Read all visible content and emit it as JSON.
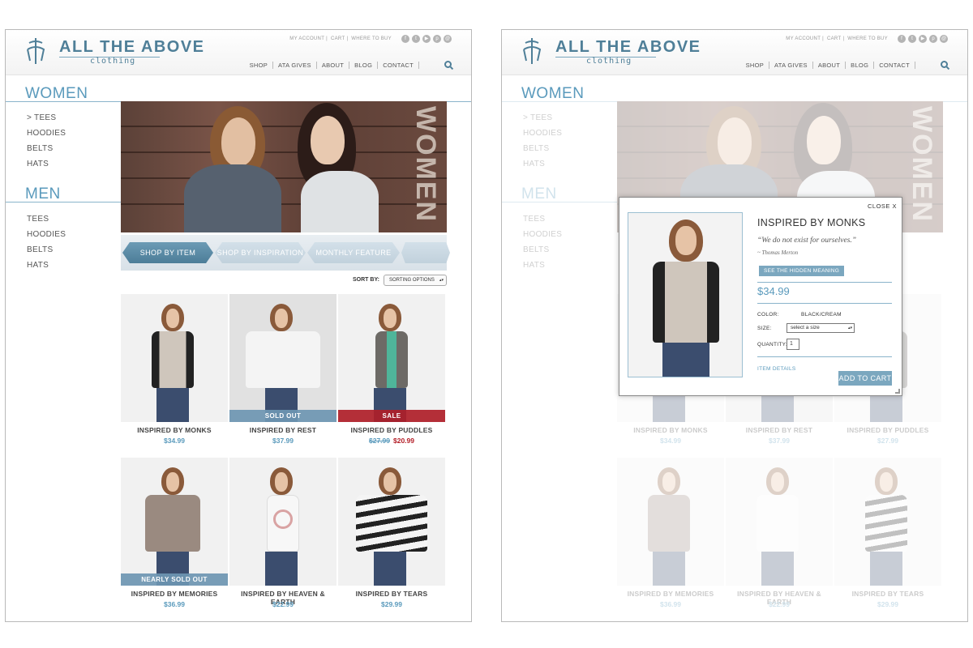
{
  "brand": {
    "title": "ALL THE ABOVE",
    "subtitle": "clothing"
  },
  "utility_links": [
    "MY ACCOUNT",
    "CART",
    "WHERE TO BUY"
  ],
  "social_icons": [
    "facebook-icon",
    "twitter-icon",
    "youtube-icon",
    "pinterest-icon",
    "email-icon"
  ],
  "nav": [
    "SHOP",
    "ATA GIVES",
    "ABOUT",
    "BLOG",
    "CONTACT"
  ],
  "sidebar": {
    "women": {
      "heading": "WOMEN",
      "items": [
        "> TEES",
        "HOODIES",
        "BELTS",
        "HATS"
      ]
    },
    "men": {
      "heading": "MEN",
      "items": [
        "TEES",
        "HOODIES",
        "BELTS",
        "HATS"
      ]
    }
  },
  "hero": {
    "word": "WOMEN"
  },
  "tabs": [
    {
      "label": "SHOP BY ITEM",
      "active": true
    },
    {
      "label": "SHOP BY INSPIRATION",
      "active": false
    },
    {
      "label": "MONTHLY FEATURE",
      "active": false
    }
  ],
  "sort": {
    "label": "SORT BY:",
    "value": "SORTING OPTIONS"
  },
  "products": [
    {
      "name": "INSPIRED BY MONKS",
      "price": "$34.99",
      "badge": "",
      "shirt_color": "#cfc6bc"
    },
    {
      "name": "INSPIRED BY REST",
      "price": "$37.99",
      "badge": "SOLD OUT",
      "shirt_color": "#eeeeee"
    },
    {
      "name": "INSPIRED BY PUDDLES",
      "old_price": "$27.99",
      "sale_price": "$20.99",
      "badge": "SALE",
      "shirt_color": "#6d6a66"
    },
    {
      "name": "INSPIRED BY MEMORIES",
      "price": "$36.99",
      "badge": "NEARLY SOLD OUT",
      "shirt_color": "#9a8a80"
    },
    {
      "name": "INSPIRED BY HEAVEN & EARTH",
      "price": "$22.99",
      "badge": "",
      "shirt_color": "#f4f4f4"
    },
    {
      "name": "INSPIRED BY TEARS",
      "price": "$29.99",
      "badge": "",
      "shirt_color": "#e8e8e8"
    }
  ],
  "modal": {
    "close": "CLOSE X",
    "title": "INSPIRED BY MONKS",
    "quote": "“We do not exist for ourselves.”",
    "author": "~ Thomas Merton",
    "hidden_meaning": "SEE THE HIDDEN MEANING",
    "price": "$34.99",
    "color_label": "COLOR:",
    "color_value": "BLACK/CREAM",
    "size_label": "SIZE:",
    "size_placeholder": "select a size",
    "quantity_label": "QUANTITY:",
    "quantity_value": "1",
    "details": "ITEM DETAILS",
    "add_to_cart": "ADD TO CART"
  },
  "colors": {
    "accent": "#5a9abc",
    "button": "#7ba7bf",
    "sale": "#b31d26"
  }
}
